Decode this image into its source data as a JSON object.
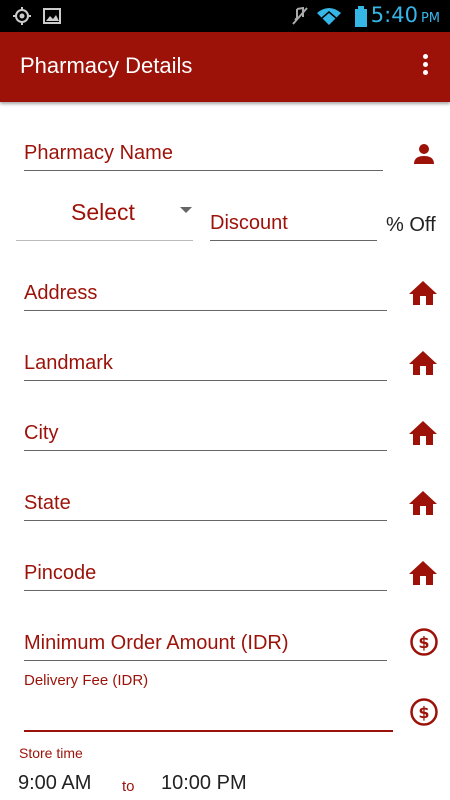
{
  "status_bar": {
    "time": "5:40",
    "ampm": "PM",
    "icons": [
      "gps-icon",
      "image-icon",
      "mute-icon",
      "wifi-icon",
      "battery-icon"
    ]
  },
  "app_bar": {
    "title": "Pharmacy Details",
    "menu_icon": "overflow-menu-icon"
  },
  "form": {
    "pharmacy_name": "Pharmacy Name",
    "select": "Select",
    "discount": "Discount",
    "discount_suffix": "% Off",
    "address": "Address",
    "landmark": "Landmark",
    "city": "City",
    "state": "State",
    "pincode": "Pincode",
    "min_order": "Minimum Order Amount (IDR)",
    "delivery_fee": "Delivery Fee (IDR)",
    "store_time_label": "Store time",
    "open_time": "9:00 AM",
    "to": "to",
    "close_time": "10:00 PM"
  },
  "colors": {
    "primary": "#9c1209",
    "status_bar": "#000000",
    "time": "#36b6e6"
  }
}
